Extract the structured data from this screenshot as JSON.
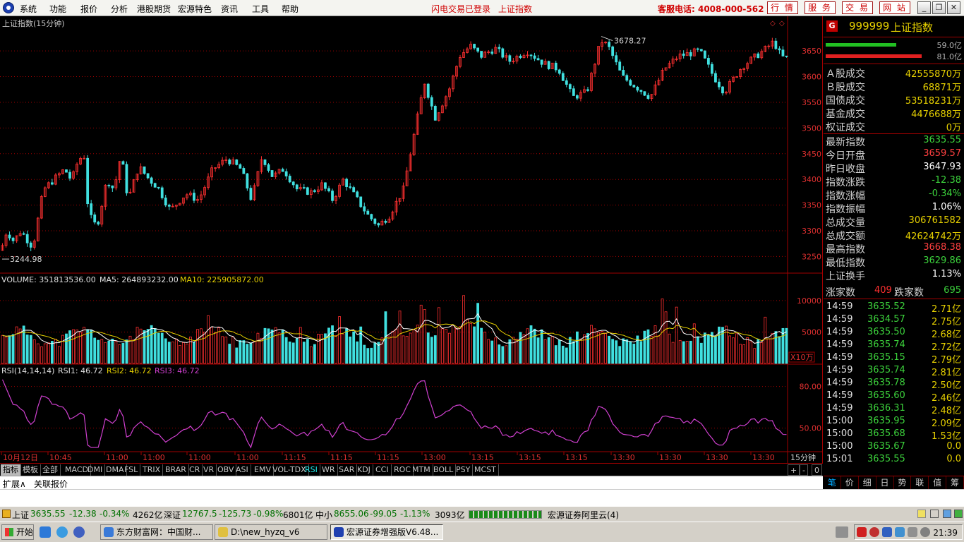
{
  "menu": {
    "items": [
      "系统",
      "功能",
      "报价",
      "分析",
      "港股期货",
      "宏源特色",
      "资讯",
      "工具",
      "帮助"
    ],
    "notice1": "闪电交易已登录",
    "notice2": "上证指数",
    "hotline": "客服电话: 4008-000-562",
    "buttons": [
      "行 情",
      "服 务",
      "交 易",
      "网 站"
    ]
  },
  "chart": {
    "title": "上证指数(15分钟)",
    "high_label": "3678.27",
    "low_label": "3244.98",
    "price_ticks": [
      "3650",
      "3600",
      "3550",
      "3500",
      "3450",
      "3400",
      "3350",
      "3300",
      "3250"
    ],
    "volume_header": {
      "vol": "VOLUME: 351813536.00",
      "ma5": "MA5: 264893232.00",
      "ma10": "MA10: 225905872.00"
    },
    "vol_ticks": [
      "10000",
      "5000"
    ],
    "vol_unit": "X10万",
    "rsi_header": {
      "label": "RSI(14,14,14)",
      "rsi1": "RSI1: 46.72",
      "rsi2": "RSI2: 46.72",
      "rsi3": "RSI3: 46.72"
    },
    "rsi_ticks": [
      "80.00",
      "50.00"
    ],
    "time_labels": [
      "10月12日",
      "10:45",
      "11:00",
      "11:00",
      "11:00",
      "11:00",
      "11:15",
      "11:15",
      "11:15",
      "13:00",
      "13:15",
      "13:15",
      "13:15",
      "13:30",
      "13:30",
      "13:30",
      "13:30",
      "13:30"
    ],
    "period": "15分钟",
    "colors": {
      "up": "#ff3030",
      "down": "#40e0e0",
      "grid": "#a00000",
      "ma5": "#ffffff",
      "ma10": "#e6d000",
      "rsi": "#d040d0"
    }
  },
  "tabs": {
    "items": [
      "指标",
      "模板",
      "全部",
      "MACD",
      "DMI",
      "DMA",
      "FSL",
      "TRIX",
      "BRAR",
      "CR",
      "VR",
      "OBV",
      "ASI",
      "EMV",
      "VOL-TDX",
      "RSI",
      "WR",
      "SAR",
      "KDJ",
      "CCI",
      "ROC",
      "MTM",
      "BOLL",
      "PSY",
      "MCST"
    ],
    "right": [
      "+",
      "-",
      "0"
    ]
  },
  "expand": {
    "a": "扩展∧",
    "b": "关联报价"
  },
  "panel": {
    "badge": "G",
    "code": "999999",
    "name": "上证指数",
    "bar1": "59.0亿",
    "bar2": "81.0亿",
    "stats": [
      {
        "k": "Ａ股成交",
        "v": "42555870万"
      },
      {
        "k": "Ｂ股成交",
        "v": "68871万"
      },
      {
        "k": "国债成交",
        "v": "53518231万"
      },
      {
        "k": "基金成交",
        "v": "4476688万"
      },
      {
        "k": "权证成交",
        "v": "0万"
      }
    ],
    "quote": [
      {
        "k": "最新指数",
        "v": "3635.55"
      },
      {
        "k": "今日开盘",
        "v": "3659.57"
      },
      {
        "k": "昨日收盘",
        "v": "3647.93"
      },
      {
        "k": "指数涨跌",
        "v": "-12.38"
      },
      {
        "k": "指数涨幅",
        "v": "-0.34%"
      },
      {
        "k": "指数振幅",
        "v": "1.06%"
      },
      {
        "k": "总成交量",
        "v": "306761582"
      },
      {
        "k": "总成交额",
        "v": "42624742万"
      },
      {
        "k": "最高指数",
        "v": "3668.38"
      },
      {
        "k": "最低指数",
        "v": "3629.86"
      },
      {
        "k": "上证换手",
        "v": "1.13%"
      }
    ],
    "up_label": "涨家数",
    "up_count": "409",
    "down_label": "跌家数",
    "down_count": "695",
    "ticks": [
      {
        "t": "14:59",
        "p": "3635.52",
        "q": "2.71亿"
      },
      {
        "t": "14:59",
        "p": "3634.57",
        "q": "2.75亿"
      },
      {
        "t": "14:59",
        "p": "3635.50",
        "q": "2.68亿"
      },
      {
        "t": "14:59",
        "p": "3635.74",
        "q": "2.72亿"
      },
      {
        "t": "14:59",
        "p": "3635.15",
        "q": "2.79亿"
      },
      {
        "t": "14:59",
        "p": "3635.74",
        "q": "2.81亿"
      },
      {
        "t": "14:59",
        "p": "3635.78",
        "q": "2.50亿"
      },
      {
        "t": "14:59",
        "p": "3635.60",
        "q": "2.46亿"
      },
      {
        "t": "14:59",
        "p": "3636.31",
        "q": "2.48亿"
      },
      {
        "t": "15:00",
        "p": "3635.95",
        "q": "2.09亿"
      },
      {
        "t": "15:00",
        "p": "3635.68",
        "q": "1.53亿"
      },
      {
        "t": "15:00",
        "p": "3635.67",
        "q": "0.0"
      },
      {
        "t": "15:01",
        "p": "3635.55",
        "q": "0.0"
      }
    ],
    "tabs": [
      "笔",
      "价",
      "细",
      "日",
      "势",
      "联",
      "值",
      "筹"
    ]
  },
  "status": {
    "sh_name": "上证",
    "sh_price": "3635.55",
    "sh_chg": "-12.38",
    "sh_pct": "-0.34%",
    "sh_amt": "4262亿",
    "sz_name": "深证",
    "sz_price": "12767.5",
    "sz_chg": "-125.73",
    "sz_pct": "-0.98%",
    "sz_amt": "6801亿",
    "zx_name": "中小",
    "zx_price": "8655.06",
    "zx_chg": "-99.05",
    "zx_pct": "-1.13%",
    "zx_amt": "3093亿",
    "server": "宏源证券阿里云(4)"
  },
  "taskbar": {
    "start": "开始",
    "tasks": [
      "东方财富网：中国财...",
      "D:\\new_hyzq_v6",
      "宏源证券增强版V6.48..."
    ],
    "clock": "21:39"
  },
  "chart_data": {
    "type": "candlestick",
    "title": "上证指数(15分钟)",
    "y_range": [
      3230,
      3690
    ],
    "high": 3678.27,
    "low": 3244.98,
    "indicators": [
      "VOLUME",
      "MA5",
      "MA10",
      "RSI"
    ],
    "last": {
      "volume": 351813536.0,
      "ma5": 264893232.0,
      "ma10": 225905872.0,
      "rsi": 46.72
    }
  }
}
